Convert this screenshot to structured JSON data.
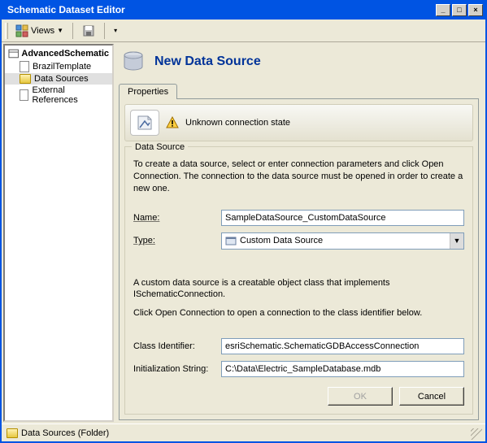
{
  "window": {
    "title": "Schematic Dataset Editor"
  },
  "toolbar": {
    "views_label": "Views"
  },
  "tree": {
    "root": "AdvancedSchematic",
    "items": [
      {
        "label": "BrazilTemplate",
        "icon": "template"
      },
      {
        "label": "Data Sources",
        "icon": "folder",
        "selected": true
      },
      {
        "label": "External References",
        "icon": "link"
      }
    ]
  },
  "header": {
    "title": "New Data Source"
  },
  "tabs": {
    "active": "Properties"
  },
  "status": {
    "text": "Unknown connection state"
  },
  "data_source": {
    "legend": "Data Source",
    "description": "To create a data source, select or enter connection parameters and click Open Connection.  The connection to the data source must be opened in order to create a new one.",
    "name_label": "Name:",
    "name_value": "SampleDataSource_CustomDataSource",
    "type_label": "Type:",
    "type_value": "Custom Data Source",
    "custom_desc_1": "A custom data source is a creatable object class that implements ISchematicConnection.",
    "custom_desc_2": "Click Open Connection to open a connection to the class identifier below.",
    "class_id_label": "Class Identifier:",
    "class_id_value": "esriSchematic.SchematicGDBAccessConnection",
    "init_str_label": "Initialization String:",
    "init_str_value": "C:\\Data\\Electric_SampleDatabase.mdb"
  },
  "buttons": {
    "ok": "OK",
    "cancel": "Cancel"
  },
  "statusbar": {
    "text": "Data Sources (Folder)"
  }
}
